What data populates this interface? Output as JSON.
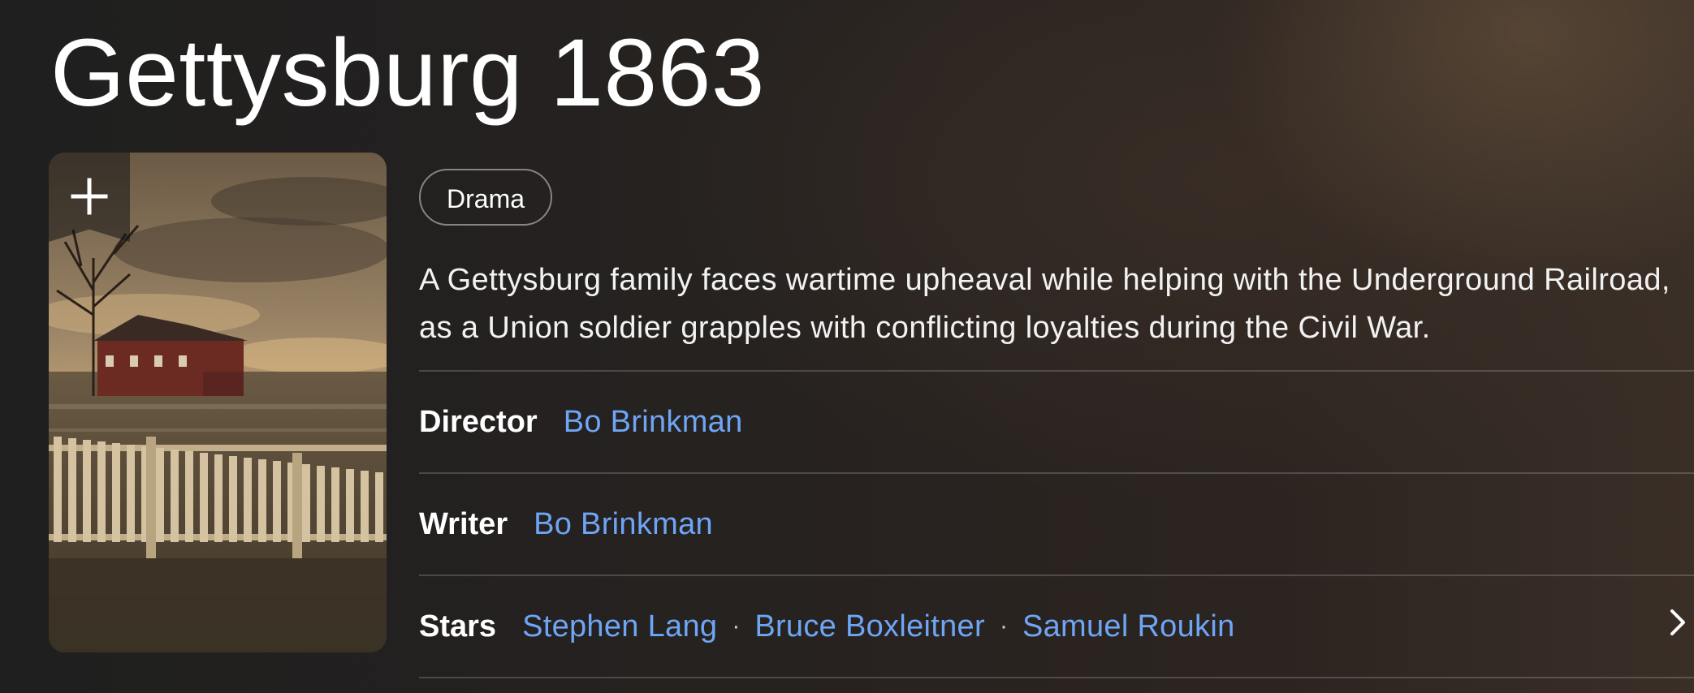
{
  "title": "Gettysburg 1863",
  "poster": {
    "watchlist_icon": "plus-icon"
  },
  "genres": [
    "Drama"
  ],
  "plot": "A Gettysburg family faces wartime upheaval while helping with the Underground Railroad, as a Union soldier grapples with conflicting loyalties during the Civil War.",
  "credits": {
    "director": {
      "label": "Director",
      "names": [
        "Bo Brinkman"
      ]
    },
    "writer": {
      "label": "Writer",
      "names": [
        "Bo Brinkman"
      ]
    },
    "stars": {
      "label": "Stars",
      "names": [
        "Stephen Lang",
        "Bruce Boxleitner",
        "Samuel Roukin"
      ],
      "separator": "·",
      "more_icon": "chevron-right-icon"
    }
  },
  "colors": {
    "link": "#6ea5f5",
    "text": "#ffffff",
    "background": "#262220"
  }
}
